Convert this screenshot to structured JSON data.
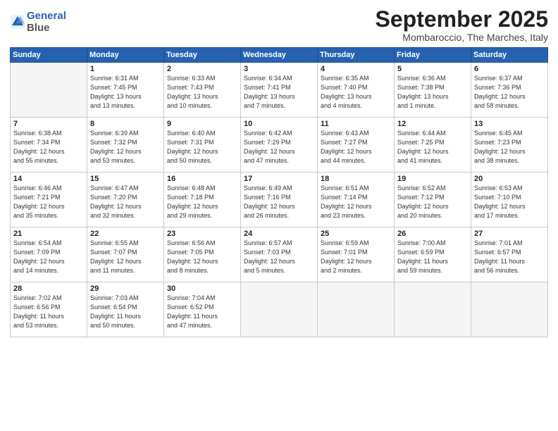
{
  "logo": {
    "line1": "General",
    "line2": "Blue"
  },
  "title": "September 2025",
  "location": "Mombaroccio, The Marches, Italy",
  "header_days": [
    "Sunday",
    "Monday",
    "Tuesday",
    "Wednesday",
    "Thursday",
    "Friday",
    "Saturday"
  ],
  "weeks": [
    [
      {
        "day": "",
        "info": ""
      },
      {
        "day": "1",
        "info": "Sunrise: 6:31 AM\nSunset: 7:45 PM\nDaylight: 13 hours\nand 13 minutes."
      },
      {
        "day": "2",
        "info": "Sunrise: 6:33 AM\nSunset: 7:43 PM\nDaylight: 13 hours\nand 10 minutes."
      },
      {
        "day": "3",
        "info": "Sunrise: 6:34 AM\nSunset: 7:41 PM\nDaylight: 13 hours\nand 7 minutes."
      },
      {
        "day": "4",
        "info": "Sunrise: 6:35 AM\nSunset: 7:40 PM\nDaylight: 13 hours\nand 4 minutes."
      },
      {
        "day": "5",
        "info": "Sunrise: 6:36 AM\nSunset: 7:38 PM\nDaylight: 13 hours\nand 1 minute."
      },
      {
        "day": "6",
        "info": "Sunrise: 6:37 AM\nSunset: 7:36 PM\nDaylight: 12 hours\nand 58 minutes."
      }
    ],
    [
      {
        "day": "7",
        "info": "Sunrise: 6:38 AM\nSunset: 7:34 PM\nDaylight: 12 hours\nand 55 minutes."
      },
      {
        "day": "8",
        "info": "Sunrise: 6:39 AM\nSunset: 7:32 PM\nDaylight: 12 hours\nand 53 minutes."
      },
      {
        "day": "9",
        "info": "Sunrise: 6:40 AM\nSunset: 7:31 PM\nDaylight: 12 hours\nand 50 minutes."
      },
      {
        "day": "10",
        "info": "Sunrise: 6:42 AM\nSunset: 7:29 PM\nDaylight: 12 hours\nand 47 minutes."
      },
      {
        "day": "11",
        "info": "Sunrise: 6:43 AM\nSunset: 7:27 PM\nDaylight: 12 hours\nand 44 minutes."
      },
      {
        "day": "12",
        "info": "Sunrise: 6:44 AM\nSunset: 7:25 PM\nDaylight: 12 hours\nand 41 minutes."
      },
      {
        "day": "13",
        "info": "Sunrise: 6:45 AM\nSunset: 7:23 PM\nDaylight: 12 hours\nand 38 minutes."
      }
    ],
    [
      {
        "day": "14",
        "info": "Sunrise: 6:46 AM\nSunset: 7:21 PM\nDaylight: 12 hours\nand 35 minutes."
      },
      {
        "day": "15",
        "info": "Sunrise: 6:47 AM\nSunset: 7:20 PM\nDaylight: 12 hours\nand 32 minutes."
      },
      {
        "day": "16",
        "info": "Sunrise: 6:48 AM\nSunset: 7:18 PM\nDaylight: 12 hours\nand 29 minutes."
      },
      {
        "day": "17",
        "info": "Sunrise: 6:49 AM\nSunset: 7:16 PM\nDaylight: 12 hours\nand 26 minutes."
      },
      {
        "day": "18",
        "info": "Sunrise: 6:51 AM\nSunset: 7:14 PM\nDaylight: 12 hours\nand 23 minutes."
      },
      {
        "day": "19",
        "info": "Sunrise: 6:52 AM\nSunset: 7:12 PM\nDaylight: 12 hours\nand 20 minutes."
      },
      {
        "day": "20",
        "info": "Sunrise: 6:53 AM\nSunset: 7:10 PM\nDaylight: 12 hours\nand 17 minutes."
      }
    ],
    [
      {
        "day": "21",
        "info": "Sunrise: 6:54 AM\nSunset: 7:09 PM\nDaylight: 12 hours\nand 14 minutes."
      },
      {
        "day": "22",
        "info": "Sunrise: 6:55 AM\nSunset: 7:07 PM\nDaylight: 12 hours\nand 11 minutes."
      },
      {
        "day": "23",
        "info": "Sunrise: 6:56 AM\nSunset: 7:05 PM\nDaylight: 12 hours\nand 8 minutes."
      },
      {
        "day": "24",
        "info": "Sunrise: 6:57 AM\nSunset: 7:03 PM\nDaylight: 12 hours\nand 5 minutes."
      },
      {
        "day": "25",
        "info": "Sunrise: 6:59 AM\nSunset: 7:01 PM\nDaylight: 12 hours\nand 2 minutes."
      },
      {
        "day": "26",
        "info": "Sunrise: 7:00 AM\nSunset: 6:59 PM\nDaylight: 11 hours\nand 59 minutes."
      },
      {
        "day": "27",
        "info": "Sunrise: 7:01 AM\nSunset: 6:57 PM\nDaylight: 11 hours\nand 56 minutes."
      }
    ],
    [
      {
        "day": "28",
        "info": "Sunrise: 7:02 AM\nSunset: 6:56 PM\nDaylight: 11 hours\nand 53 minutes."
      },
      {
        "day": "29",
        "info": "Sunrise: 7:03 AM\nSunset: 6:54 PM\nDaylight: 11 hours\nand 50 minutes."
      },
      {
        "day": "30",
        "info": "Sunrise: 7:04 AM\nSunset: 6:52 PM\nDaylight: 11 hours\nand 47 minutes."
      },
      {
        "day": "",
        "info": ""
      },
      {
        "day": "",
        "info": ""
      },
      {
        "day": "",
        "info": ""
      },
      {
        "day": "",
        "info": ""
      }
    ]
  ]
}
